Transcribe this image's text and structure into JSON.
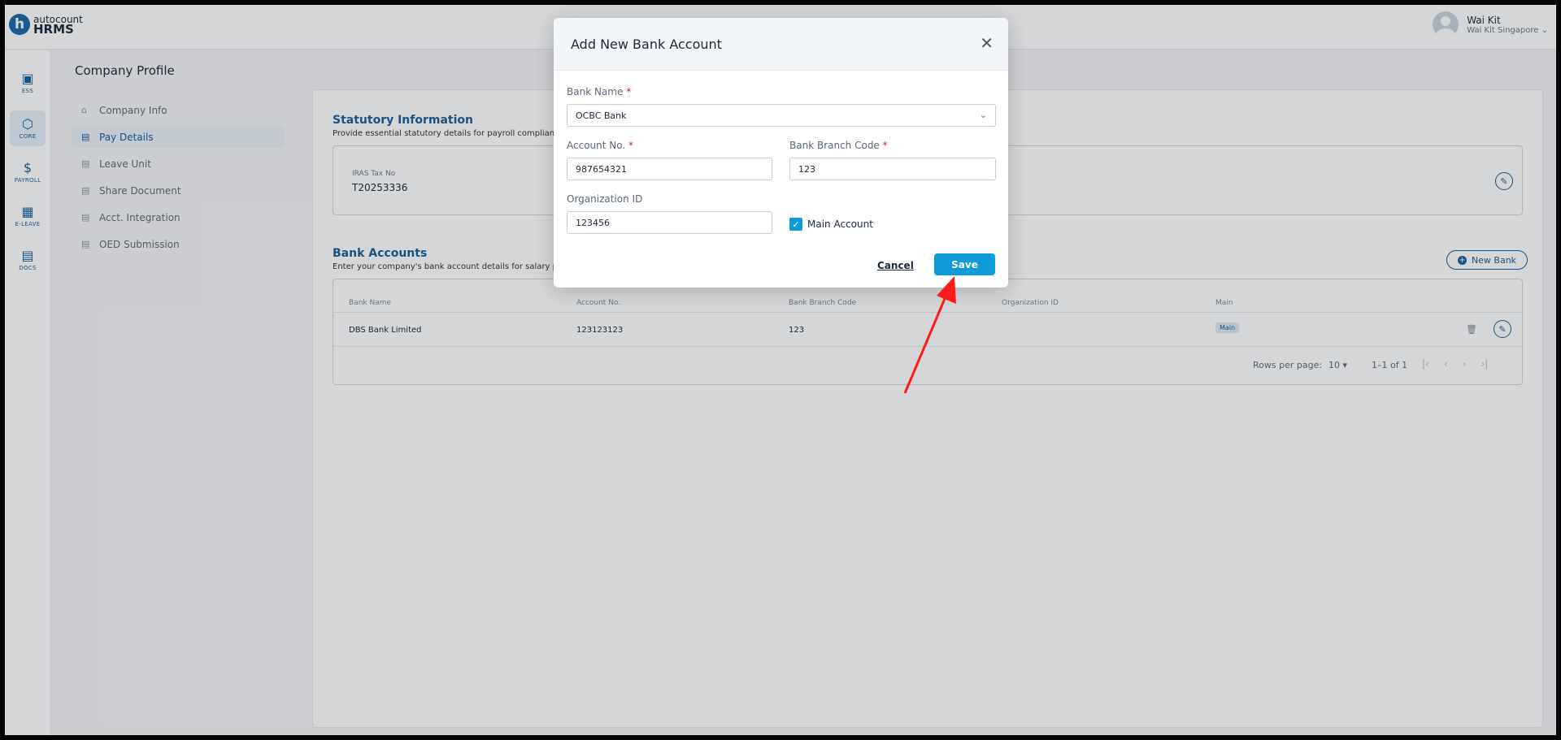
{
  "app": {
    "logo_top": "autocount",
    "logo_bottom": "HRMS",
    "logo_mark": "h"
  },
  "user": {
    "name": "Wai Kit",
    "org": "Wai Kit Singapore"
  },
  "rail": [
    {
      "label": "ESS",
      "icon": "user-card-icon",
      "glyph": "▣"
    },
    {
      "label": "CORE",
      "icon": "cube-icon",
      "glyph": "⬡"
    },
    {
      "label": "PAYROLL",
      "icon": "dollar-icon",
      "glyph": "$"
    },
    {
      "label": "E-LEAVE",
      "icon": "calendar-icon",
      "glyph": "▦"
    },
    {
      "label": "DOCS",
      "icon": "chart-doc-icon",
      "glyph": "▤"
    }
  ],
  "page": {
    "title": "Company Profile"
  },
  "subnav": [
    {
      "label": "Company Info",
      "glyph": "⌂"
    },
    {
      "label": "Pay Details",
      "glyph": "▤"
    },
    {
      "label": "Leave Unit",
      "glyph": "▤"
    },
    {
      "label": "Share Document",
      "glyph": "▤"
    },
    {
      "label": "Acct. Integration",
      "glyph": "▤"
    },
    {
      "label": "OED Submission",
      "glyph": "▤"
    }
  ],
  "statutory": {
    "title": "Statutory Information",
    "desc": "Provide essential statutory details for payroll compliance",
    "label": "IRAS Tax No",
    "value": "T20253336"
  },
  "bank_accounts": {
    "title": "Bank Accounts",
    "desc": "Enter your company's bank account details for salary pa",
    "new_bank_label": "New Bank",
    "columns": [
      "Bank Name",
      "Account No.",
      "Bank Branch Code",
      "Organization ID",
      "Main"
    ],
    "rows": [
      {
        "bank_name": "DBS Bank Limited",
        "account_no": "123123123",
        "branch_code": "123",
        "org_id": "",
        "main": "Main"
      }
    ],
    "rows_per_page_label": "Rows per page:",
    "rows_per_page_value": "10",
    "range": "1–1 of 1"
  },
  "modal": {
    "title": "Add New Bank Account",
    "bank_name_label": "Bank Name",
    "bank_name_value": "OCBC Bank",
    "account_no_label": "Account No.",
    "account_no_value": "987654321",
    "branch_code_label": "Bank Branch Code",
    "branch_code_value": "123",
    "org_id_label": "Organization ID",
    "org_id_value": "123456",
    "main_account_label": "Main Account",
    "main_account_checked": true,
    "cancel_label": "Cancel",
    "save_label": "Save",
    "required_mark": "*"
  },
  "colors": {
    "accent": "#0f9ad8",
    "brand": "#1a5f96",
    "annotation_arrow": "#ff1a1a"
  }
}
